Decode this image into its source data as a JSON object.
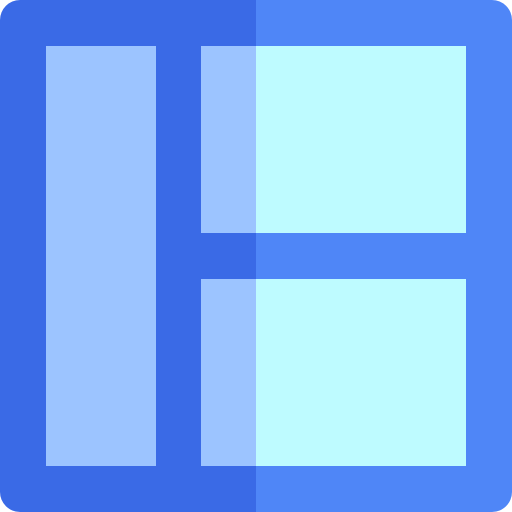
{
  "icon": {
    "name": "layout-grid-icon",
    "colors": {
      "frame_left": "#3A6AE6",
      "frame_right": "#4F86F7",
      "panel_left": "#9CC4FF",
      "panel_right": "#BEFBFF"
    }
  }
}
